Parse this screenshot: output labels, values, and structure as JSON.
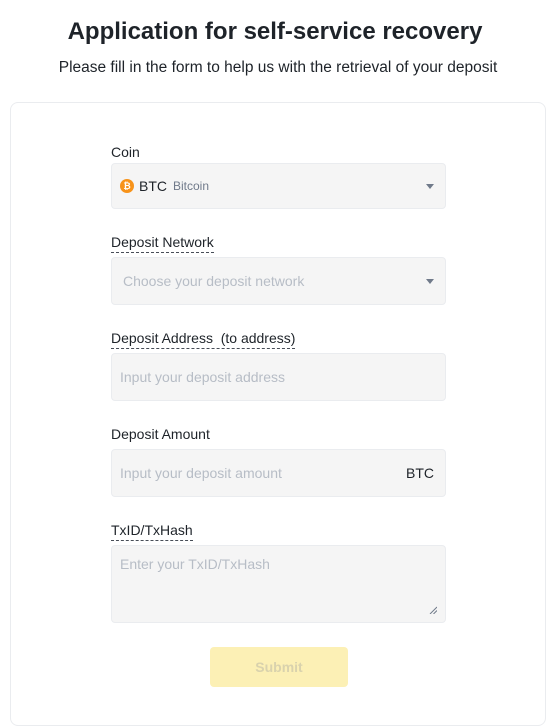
{
  "header": {
    "title": "Application for self-service recovery",
    "subtitle": "Please fill in the form to help us with the retrieval of your deposit"
  },
  "form": {
    "coin": {
      "label": "Coin",
      "selected_symbol": "BTC",
      "selected_name": "Bitcoin",
      "icon": "bitcoin-icon",
      "icon_glyph": "₿",
      "icon_color": "#f7931a"
    },
    "network": {
      "label": "Deposit Network",
      "placeholder": "Choose your deposit network"
    },
    "address": {
      "label": "Deposit Address  (to address)",
      "placeholder": "Input your deposit address",
      "value": ""
    },
    "amount": {
      "label": "Deposit Amount",
      "placeholder": "Input your deposit amount",
      "value": "",
      "unit": "BTC"
    },
    "txid": {
      "label": "TxID/TxHash",
      "placeholder": "Enter your TxID/TxHash",
      "value": ""
    },
    "submit_label": "Submit"
  },
  "colors": {
    "brand_yellow": "#fcd535",
    "submit_disabled_bg": "#fcf0b5",
    "input_bg": "#f5f5f5",
    "placeholder_text": "#b7bdc6",
    "bitcoin_orange": "#f7931a"
  }
}
